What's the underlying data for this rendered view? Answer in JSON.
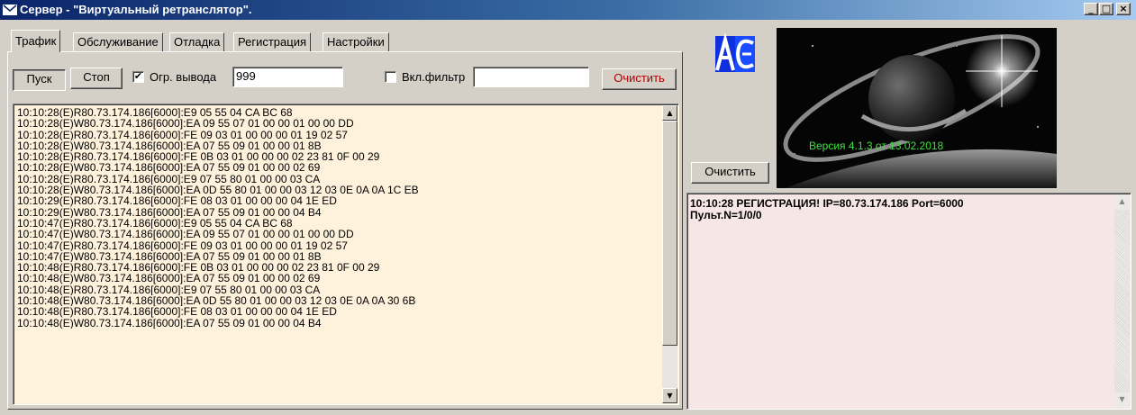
{
  "window": {
    "title": "Сервер - \"Виртуальный ретранслятор\".",
    "min_glyph": "_",
    "max_glyph": "□",
    "close_glyph": "×"
  },
  "tabs": [
    {
      "label": "Трафик",
      "active": true
    },
    {
      "label": "Обслуживание"
    },
    {
      "label": "Отладка"
    },
    {
      "label": "Регистрация"
    },
    {
      "label": "Настройки"
    }
  ],
  "toolbar": {
    "start_label": "Пуск",
    "stop_label": "Стоп",
    "limit_checked_glyph": "✔",
    "limit_label": "Огр. вывода",
    "limit_value": "999",
    "filter_label": "Вкл.фильтр",
    "filter_value": "",
    "clear_label": "Очистить"
  },
  "traffic_log": {
    "lines": [
      "10:10:28(E)R80.73.174.186[6000]:E9 05 55 04 CA BC 68",
      "10:10:28(E)W80.73.174.186[6000]:EA 09 55 07 01 00 00 01 00 00 DD",
      "10:10:28(E)R80.73.174.186[6000]:FE 09 03 01 00 00 00 01 19 02 57",
      "10:10:28(E)W80.73.174.186[6000]:EA 07 55 09 01 00 00 01 8B",
      "10:10:28(E)R80.73.174.186[6000]:FE 0B 03 01 00 00 00 02 23 81 0F 00 29",
      "10:10:28(E)W80.73.174.186[6000]:EA 07 55 09 01 00 00 02 69",
      "10:10:28(E)R80.73.174.186[6000]:E9 07 55 80 01 00 00 03 CA",
      "10:10:28(E)W80.73.174.186[6000]:EA 0D 55 80 01 00 00 03 12 03 0E 0A 0A 1C EB",
      "10:10:29(E)R80.73.174.186[6000]:FE 08 03 01 00 00 00 04 1E ED",
      "10:10:29(E)W80.73.174.186[6000]:EA 07 55 09 01 00 00 04 B4",
      "10:10:47(E)R80.73.174.186[6000]:E9 05 55 04 CA BC 68",
      "10:10:47(E)W80.73.174.186[6000]:EA 09 55 07 01 00 00 01 00 00 DD",
      "10:10:47(E)R80.73.174.186[6000]:FE 09 03 01 00 00 00 01 19 02 57",
      "10:10:47(E)W80.73.174.186[6000]:EA 07 55 09 01 00 00 01 8B",
      "10:10:48(E)R80.73.174.186[6000]:FE 0B 03 01 00 00 00 02 23 81 0F 00 29",
      "10:10:48(E)W80.73.174.186[6000]:EA 07 55 09 01 00 00 02 69",
      "10:10:48(E)R80.73.174.186[6000]:E9 07 55 80 01 00 00 03 CA",
      "10:10:48(E)W80.73.174.186[6000]:EA 0D 55 80 01 00 00 03 12 03 0E 0A 0A 30 6B",
      "10:10:48(E)R80.73.174.186[6000]:FE 08 03 01 00 00 00 04 1E ED",
      "10:10:48(E)W80.73.174.186[6000]:EA 07 55 09 01 00 00 04 B4"
    ],
    "scroll_up_glyph": "▲",
    "scroll_down_glyph": "▼"
  },
  "right_panel": {
    "version_text": "Версия   4.1.3 от 13.02.2018",
    "clear_label": "Очистить",
    "message_lines": [
      "10:10:28  РЕГИСТРАЦИЯ! IP=80.73.174.186 Port=6000",
      "Пульт.N=1/0/0"
    ],
    "scroll_up_glyph": "▲",
    "scroll_down_glyph": "▼"
  },
  "colors": {
    "title_bar": "#0a246a",
    "traffic_bg": "#fff2dc",
    "message_bg": "#f6e6e6",
    "version_text": "#3fe03f",
    "clear_button_text": "#b00000"
  }
}
